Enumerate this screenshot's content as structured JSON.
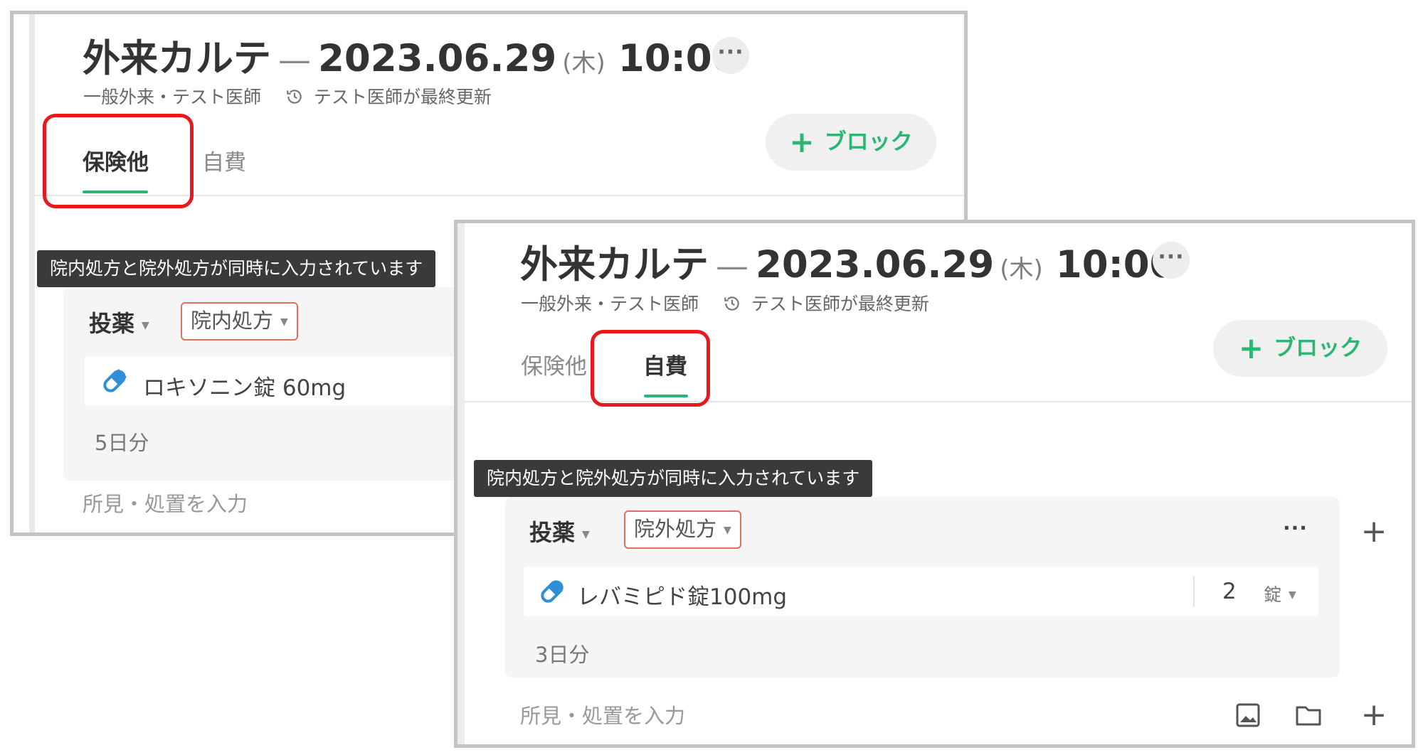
{
  "colors": {
    "accent_green": "#2bb673",
    "highlight_red": "#e8181f",
    "tag_border": "#e07060"
  },
  "common": {
    "title": "外来カルテ",
    "dash": "—",
    "date": "2023.06.29",
    "weekday": "(木)",
    "time": "10:00",
    "more": "···",
    "department": "一般外来・テスト医師",
    "updated_by": "テスト医師が最終更新",
    "tab_insurance": "保険他",
    "tab_self_pay": "自費",
    "block_button": "ブロック",
    "block_plus": "+",
    "warning": "院内処方と院外処方が同時に入力されています",
    "medication_label": "投薬",
    "findings_placeholder": "所見・処置を入力"
  },
  "panel_a": {
    "active_tab": "保険他",
    "prescription_type": "院内処方",
    "medication": "ロキソニン錠 60mg",
    "days": "5日分"
  },
  "panel_b": {
    "active_tab": "自費",
    "prescription_type": "院外処方",
    "medication": "レバミピド錠100mg",
    "quantity": "2",
    "unit": "錠",
    "days": "3日分",
    "card_more": "···",
    "add": "+"
  },
  "icons": [
    "history-icon",
    "pill-icon",
    "image-icon",
    "folder-icon",
    "plus-icon",
    "more-icon",
    "caret-down-icon"
  ]
}
